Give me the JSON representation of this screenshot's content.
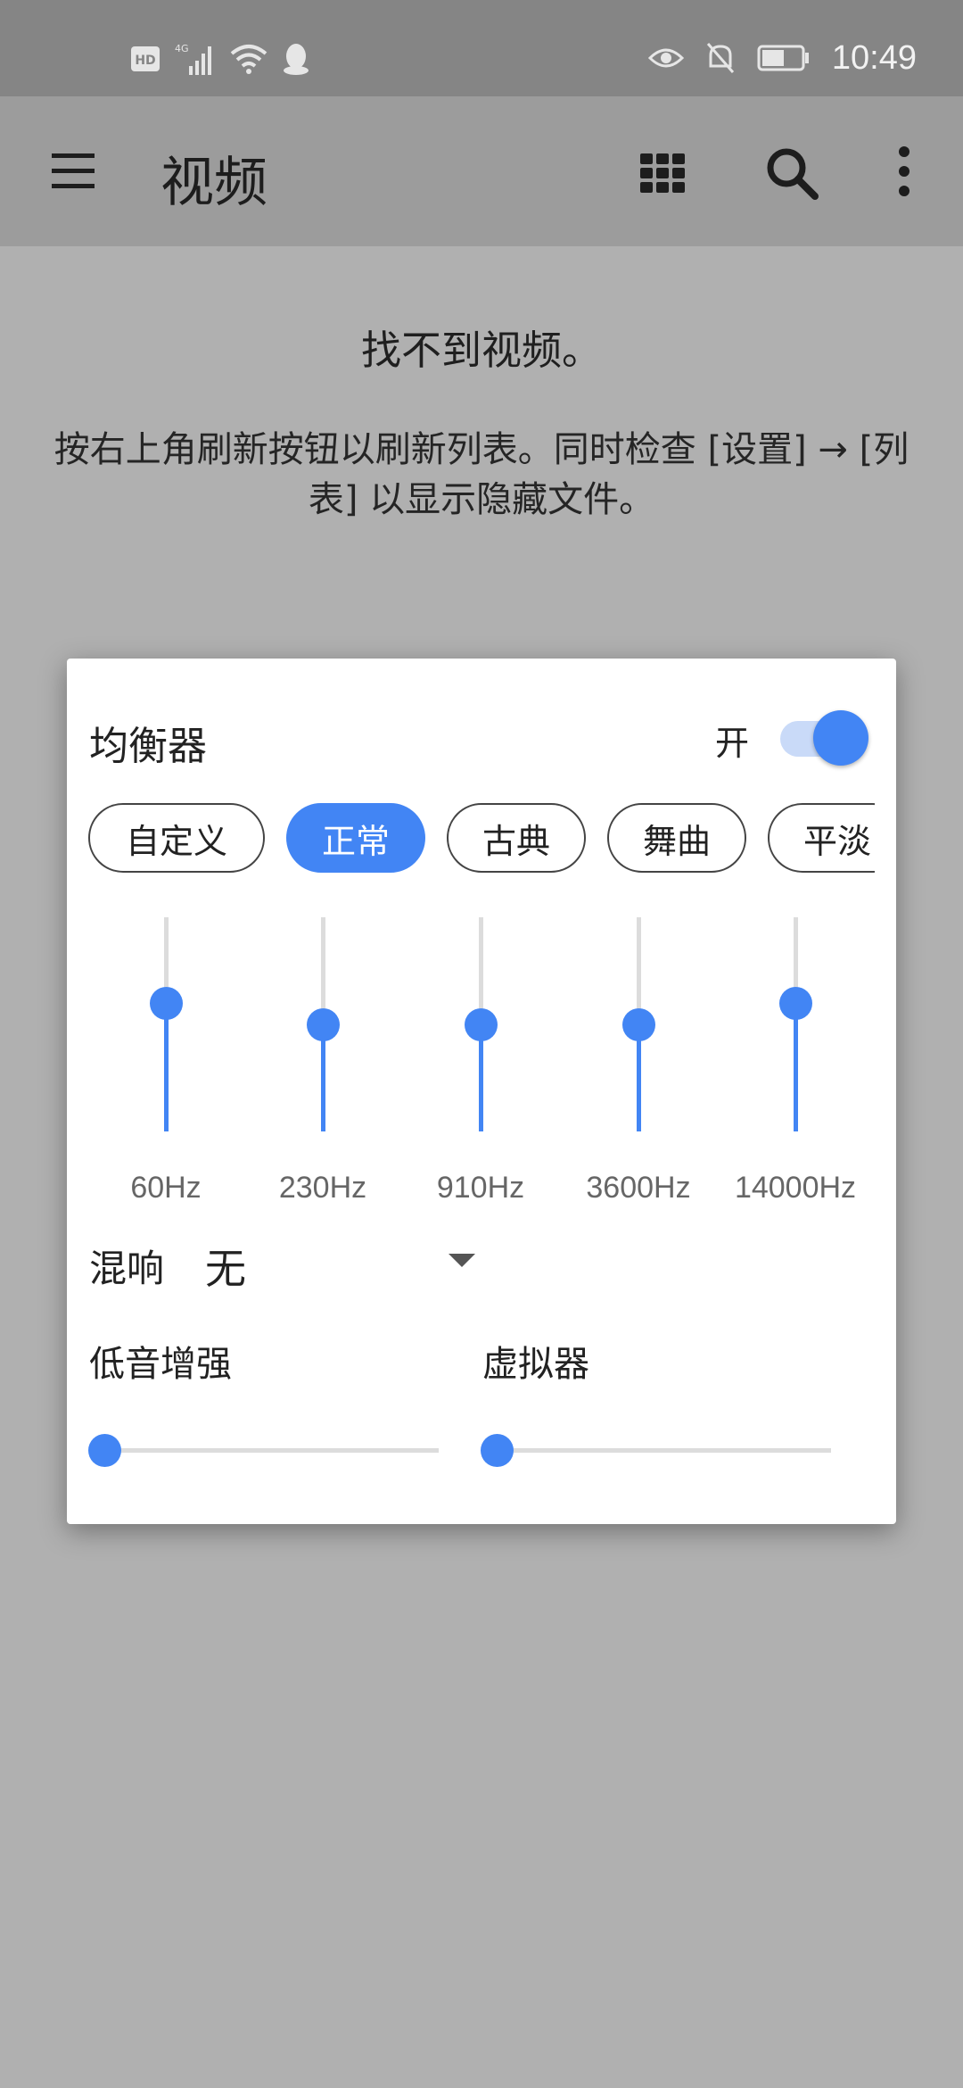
{
  "status_bar": {
    "time": "10:49",
    "network_badge": "4G"
  },
  "app_bar": {
    "title": "视频"
  },
  "empty_state": {
    "title": "找不到视频。",
    "description": "按右上角刷新按钮以刷新列表。同时检查 [设置] → [列表] 以显示隐藏文件。"
  },
  "equalizer": {
    "title": "均衡器",
    "switch_label": "开",
    "enabled": true,
    "presets": [
      {
        "label": "自定义",
        "active": false
      },
      {
        "label": "正常",
        "active": true
      },
      {
        "label": "古典",
        "active": false
      },
      {
        "label": "舞曲",
        "active": false
      },
      {
        "label": "平淡",
        "active": false
      }
    ],
    "bands": [
      {
        "label": "60Hz",
        "level": 0.6
      },
      {
        "label": "230Hz",
        "level": 0.5
      },
      {
        "label": "910Hz",
        "level": 0.5
      },
      {
        "label": "3600Hz",
        "level": 0.5
      },
      {
        "label": "14000Hz",
        "level": 0.6
      }
    ],
    "reverb": {
      "label": "混响",
      "value": "无"
    },
    "bass_boost": {
      "label": "低音增强",
      "level": 0
    },
    "virtualizer": {
      "label": "虚拟器",
      "level": 0
    },
    "accent_color": "#4285f4"
  }
}
